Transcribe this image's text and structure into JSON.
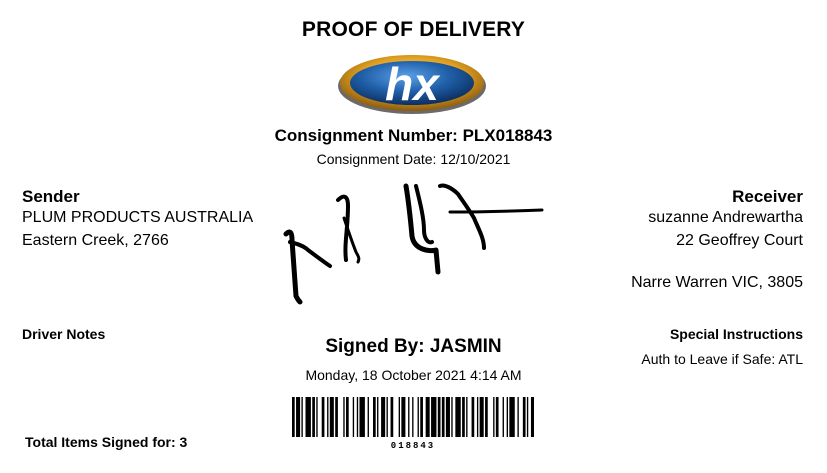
{
  "document": {
    "title": "PROOF OF DELIVERY",
    "logo_text": "hx",
    "consignment_number": "Consignment Number: PLX018843",
    "consignment_date": "Consignment Date: 12/10/2021"
  },
  "sender": {
    "heading": "Sender",
    "name": "PLUM PRODUCTS AUSTRALIA",
    "address": "Eastern Creek, 2766"
  },
  "receiver": {
    "heading": "Receiver",
    "name": "suzanne Andrewartha",
    "address_line1": "22 Geoffrey Court",
    "address_line2": "Narre Warren VIC, 3805"
  },
  "driver_notes": {
    "heading": "Driver Notes"
  },
  "special_instructions": {
    "heading": "Special Instructions",
    "text": "Auth to Leave if Safe: ATL"
  },
  "signature": {
    "signed_by": "Signed By: JASMIN",
    "signed_date": "Monday, 18 October 2021 4:14 AM"
  },
  "barcode": {
    "number": "018843"
  },
  "totals": {
    "items_signed": "Total Items Signed for: 3"
  },
  "colors": {
    "logo_blue": "#1f5fa8",
    "logo_gold": "#e0a020",
    "ink": "#000000"
  }
}
